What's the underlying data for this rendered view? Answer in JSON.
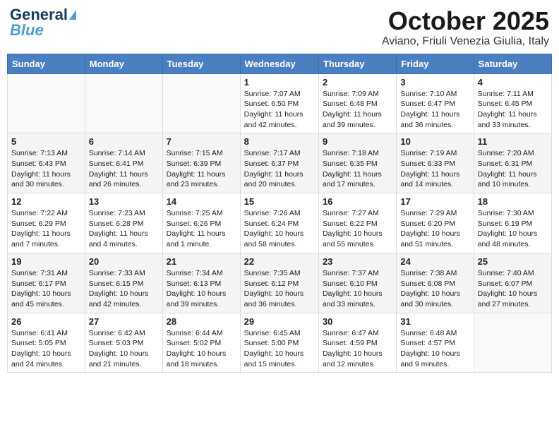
{
  "header": {
    "logo_line1": "General",
    "logo_line2": "Blue",
    "month": "October 2025",
    "location": "Aviano, Friuli Venezia Giulia, Italy"
  },
  "weekdays": [
    "Sunday",
    "Monday",
    "Tuesday",
    "Wednesday",
    "Thursday",
    "Friday",
    "Saturday"
  ],
  "weeks": [
    [
      {
        "day": "",
        "sunrise": "",
        "sunset": "",
        "daylight": ""
      },
      {
        "day": "",
        "sunrise": "",
        "sunset": "",
        "daylight": ""
      },
      {
        "day": "",
        "sunrise": "",
        "sunset": "",
        "daylight": ""
      },
      {
        "day": "1",
        "sunrise": "Sunrise: 7:07 AM",
        "sunset": "Sunset: 6:50 PM",
        "daylight": "Daylight: 11 hours and 42 minutes."
      },
      {
        "day": "2",
        "sunrise": "Sunrise: 7:09 AM",
        "sunset": "Sunset: 6:48 PM",
        "daylight": "Daylight: 11 hours and 39 minutes."
      },
      {
        "day": "3",
        "sunrise": "Sunrise: 7:10 AM",
        "sunset": "Sunset: 6:47 PM",
        "daylight": "Daylight: 11 hours and 36 minutes."
      },
      {
        "day": "4",
        "sunrise": "Sunrise: 7:11 AM",
        "sunset": "Sunset: 6:45 PM",
        "daylight": "Daylight: 11 hours and 33 minutes."
      }
    ],
    [
      {
        "day": "5",
        "sunrise": "Sunrise: 7:13 AM",
        "sunset": "Sunset: 6:43 PM",
        "daylight": "Daylight: 11 hours and 30 minutes."
      },
      {
        "day": "6",
        "sunrise": "Sunrise: 7:14 AM",
        "sunset": "Sunset: 6:41 PM",
        "daylight": "Daylight: 11 hours and 26 minutes."
      },
      {
        "day": "7",
        "sunrise": "Sunrise: 7:15 AM",
        "sunset": "Sunset: 6:39 PM",
        "daylight": "Daylight: 11 hours and 23 minutes."
      },
      {
        "day": "8",
        "sunrise": "Sunrise: 7:17 AM",
        "sunset": "Sunset: 6:37 PM",
        "daylight": "Daylight: 11 hours and 20 minutes."
      },
      {
        "day": "9",
        "sunrise": "Sunrise: 7:18 AM",
        "sunset": "Sunset: 6:35 PM",
        "daylight": "Daylight: 11 hours and 17 minutes."
      },
      {
        "day": "10",
        "sunrise": "Sunrise: 7:19 AM",
        "sunset": "Sunset: 6:33 PM",
        "daylight": "Daylight: 11 hours and 14 minutes."
      },
      {
        "day": "11",
        "sunrise": "Sunrise: 7:20 AM",
        "sunset": "Sunset: 6:31 PM",
        "daylight": "Daylight: 11 hours and 10 minutes."
      }
    ],
    [
      {
        "day": "12",
        "sunrise": "Sunrise: 7:22 AM",
        "sunset": "Sunset: 6:29 PM",
        "daylight": "Daylight: 11 hours and 7 minutes."
      },
      {
        "day": "13",
        "sunrise": "Sunrise: 7:23 AM",
        "sunset": "Sunset: 6:28 PM",
        "daylight": "Daylight: 11 hours and 4 minutes."
      },
      {
        "day": "14",
        "sunrise": "Sunrise: 7:25 AM",
        "sunset": "Sunset: 6:26 PM",
        "daylight": "Daylight: 11 hours and 1 minute."
      },
      {
        "day": "15",
        "sunrise": "Sunrise: 7:26 AM",
        "sunset": "Sunset: 6:24 PM",
        "daylight": "Daylight: 10 hours and 58 minutes."
      },
      {
        "day": "16",
        "sunrise": "Sunrise: 7:27 AM",
        "sunset": "Sunset: 6:22 PM",
        "daylight": "Daylight: 10 hours and 55 minutes."
      },
      {
        "day": "17",
        "sunrise": "Sunrise: 7:29 AM",
        "sunset": "Sunset: 6:20 PM",
        "daylight": "Daylight: 10 hours and 51 minutes."
      },
      {
        "day": "18",
        "sunrise": "Sunrise: 7:30 AM",
        "sunset": "Sunset: 6:19 PM",
        "daylight": "Daylight: 10 hours and 48 minutes."
      }
    ],
    [
      {
        "day": "19",
        "sunrise": "Sunrise: 7:31 AM",
        "sunset": "Sunset: 6:17 PM",
        "daylight": "Daylight: 10 hours and 45 minutes."
      },
      {
        "day": "20",
        "sunrise": "Sunrise: 7:33 AM",
        "sunset": "Sunset: 6:15 PM",
        "daylight": "Daylight: 10 hours and 42 minutes."
      },
      {
        "day": "21",
        "sunrise": "Sunrise: 7:34 AM",
        "sunset": "Sunset: 6:13 PM",
        "daylight": "Daylight: 10 hours and 39 minutes."
      },
      {
        "day": "22",
        "sunrise": "Sunrise: 7:35 AM",
        "sunset": "Sunset: 6:12 PM",
        "daylight": "Daylight: 10 hours and 36 minutes."
      },
      {
        "day": "23",
        "sunrise": "Sunrise: 7:37 AM",
        "sunset": "Sunset: 6:10 PM",
        "daylight": "Daylight: 10 hours and 33 minutes."
      },
      {
        "day": "24",
        "sunrise": "Sunrise: 7:38 AM",
        "sunset": "Sunset: 6:08 PM",
        "daylight": "Daylight: 10 hours and 30 minutes."
      },
      {
        "day": "25",
        "sunrise": "Sunrise: 7:40 AM",
        "sunset": "Sunset: 6:07 PM",
        "daylight": "Daylight: 10 hours and 27 minutes."
      }
    ],
    [
      {
        "day": "26",
        "sunrise": "Sunrise: 6:41 AM",
        "sunset": "Sunset: 5:05 PM",
        "daylight": "Daylight: 10 hours and 24 minutes."
      },
      {
        "day": "27",
        "sunrise": "Sunrise: 6:42 AM",
        "sunset": "Sunset: 5:03 PM",
        "daylight": "Daylight: 10 hours and 21 minutes."
      },
      {
        "day": "28",
        "sunrise": "Sunrise: 6:44 AM",
        "sunset": "Sunset: 5:02 PM",
        "daylight": "Daylight: 10 hours and 18 minutes."
      },
      {
        "day": "29",
        "sunrise": "Sunrise: 6:45 AM",
        "sunset": "Sunset: 5:00 PM",
        "daylight": "Daylight: 10 hours and 15 minutes."
      },
      {
        "day": "30",
        "sunrise": "Sunrise: 6:47 AM",
        "sunset": "Sunset: 4:59 PM",
        "daylight": "Daylight: 10 hours and 12 minutes."
      },
      {
        "day": "31",
        "sunrise": "Sunrise: 6:48 AM",
        "sunset": "Sunset: 4:57 PM",
        "daylight": "Daylight: 10 hours and 9 minutes."
      },
      {
        "day": "",
        "sunrise": "",
        "sunset": "",
        "daylight": ""
      }
    ]
  ]
}
